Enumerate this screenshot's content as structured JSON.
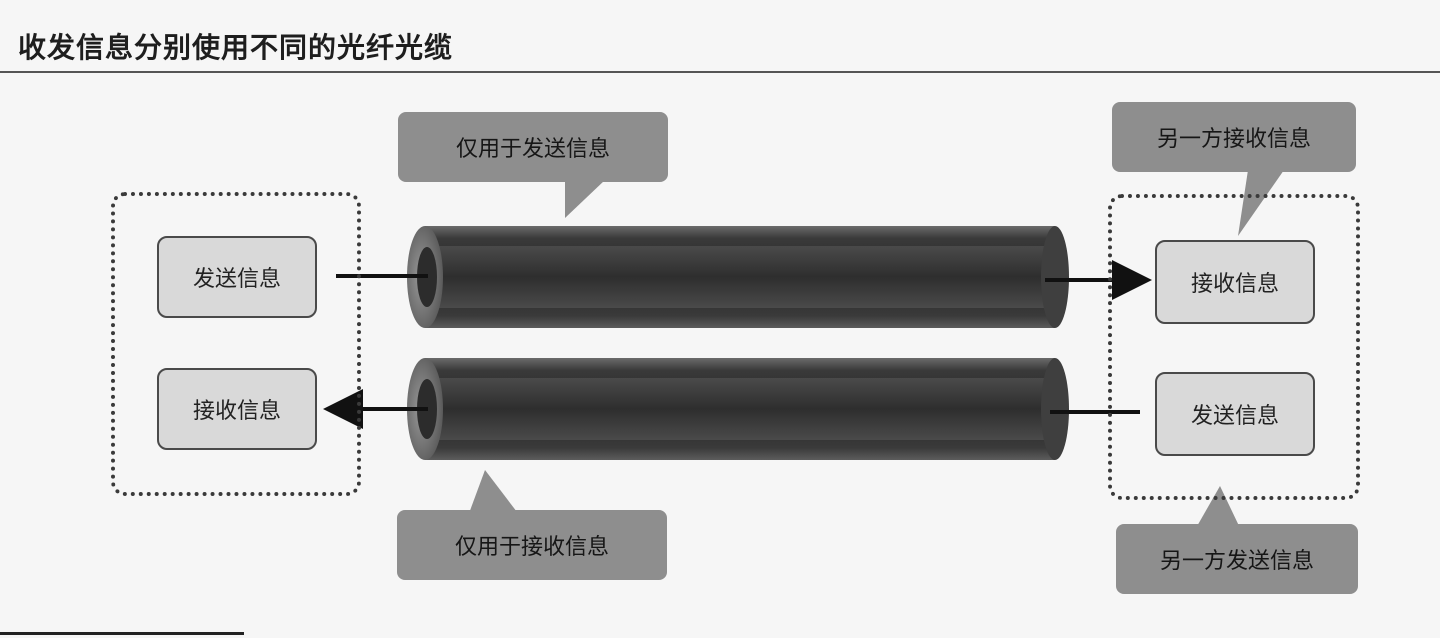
{
  "title": "收发信息分别使用不同的光纤光缆",
  "callouts": {
    "send_only": "仅用于发送信息",
    "receive_only": "仅用于接收信息",
    "other_receive": "另一方接收信息",
    "other_send": "另一方发送信息"
  },
  "left_group": {
    "send": "发送信息",
    "receive": "接收信息"
  },
  "right_group": {
    "receive": "接收信息",
    "send": "发送信息"
  },
  "colors": {
    "cable_dark": "#2b2b2b",
    "callout": "#8e8e8e",
    "box": "#d9d9d9"
  }
}
